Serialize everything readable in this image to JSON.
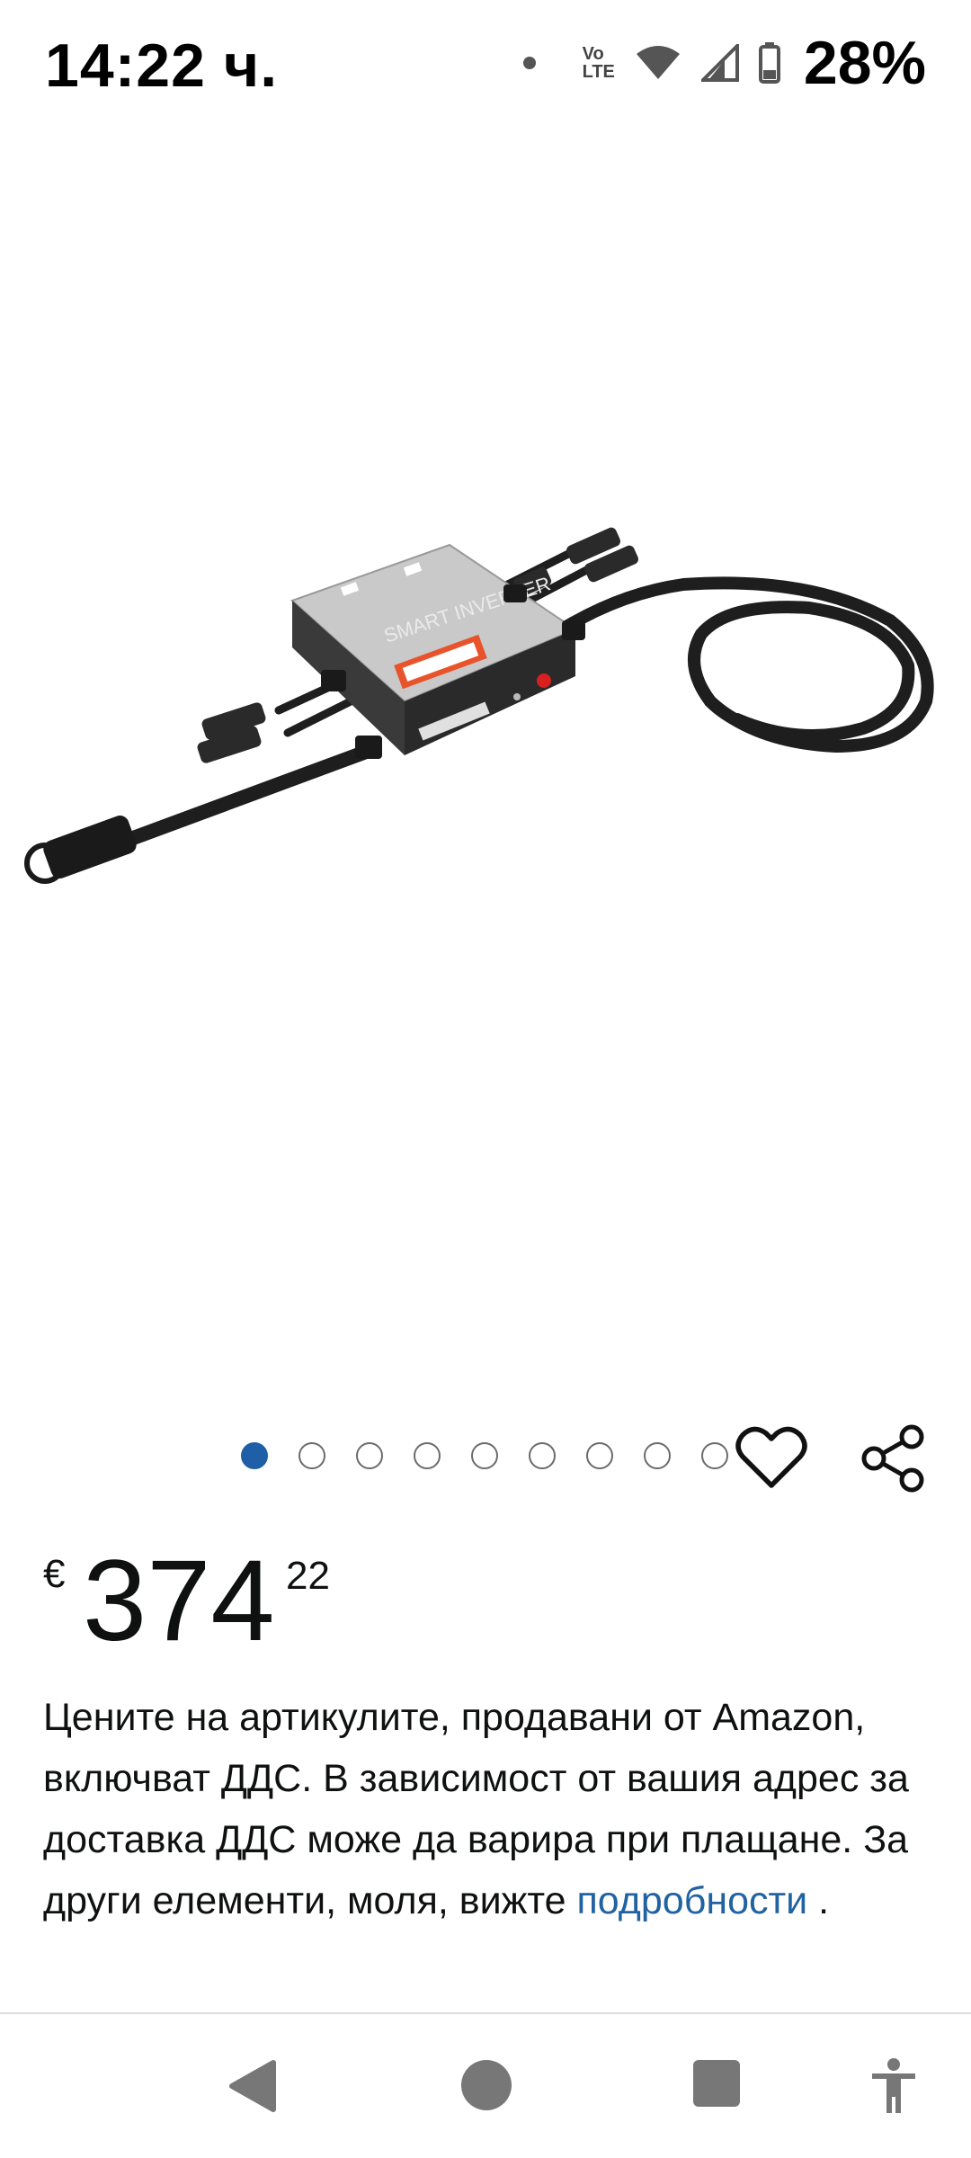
{
  "status_bar": {
    "time": "14:22 ч.",
    "network_type_top": "Vo",
    "network_type_bottom": "LTE",
    "battery_percent": "28%"
  },
  "product": {
    "image_label": "SMART INVERTER",
    "image_count": 9,
    "active_image_index": 0
  },
  "price": {
    "currency": "€",
    "whole": "374",
    "fraction": "22"
  },
  "vat_note": {
    "text": "Цените на артикулите, продавани от Amazon, включват ДДС. В зависимост от вашия адрес за доставка ДДС може да варира при плащане. За други елементи, моля, вижте",
    "link_text": "подробности",
    "suffix": " ."
  },
  "colors": {
    "link": "#2162a1",
    "active_dot": "#1f5fa8"
  },
  "icons": {
    "wishlist": "heart-icon",
    "share": "share-icon",
    "back": "back-triangle-icon",
    "home": "home-circle-icon",
    "recents": "recents-square-icon",
    "accessibility": "accessibility-icon"
  }
}
